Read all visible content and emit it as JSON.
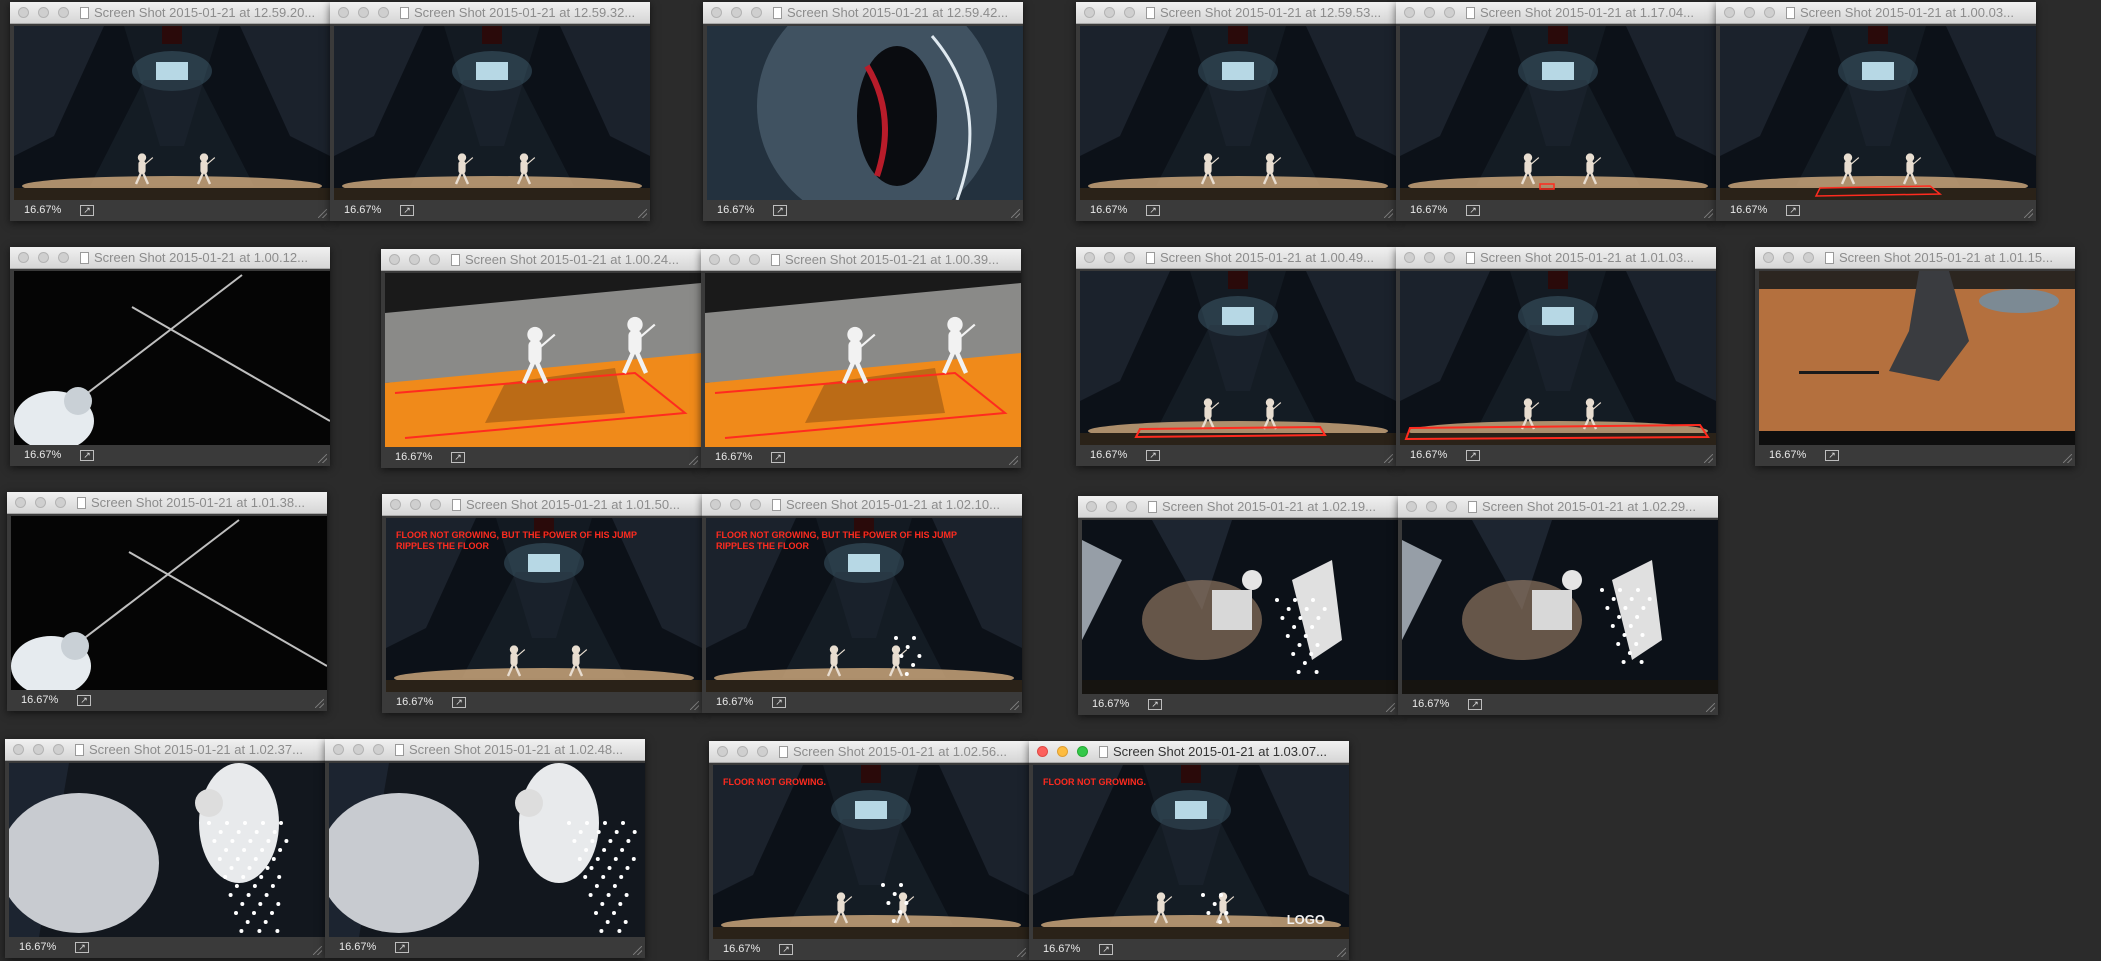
{
  "zoom_label": "16.67%",
  "share_glyph": "↗",
  "colors": {
    "desktop": "#2b2b2b",
    "overlay_red": "#ff2b1f",
    "floor_orange": "#f08a1a",
    "close_red": "#fc605c",
    "minimize_yellow": "#fdbc40",
    "zoom_green": "#34c84a"
  },
  "windows": [
    {
      "title": "Screen Shot 2015-01-21 at 12.59.20...",
      "scene": "arena"
    },
    {
      "title": "Screen Shot 2015-01-21 at 12.59.32...",
      "scene": "arena"
    },
    {
      "title": "Screen Shot 2015-01-21 at 12.59.42...",
      "scene": "mask"
    },
    {
      "title": "Screen Shot 2015-01-21 at 12.59.53...",
      "scene": "arena"
    },
    {
      "title": "Screen Shot 2015-01-21 at 1.17.04...",
      "scene": "arena"
    },
    {
      "title": "Screen Shot 2015-01-21 at 1.00.03...",
      "scene": "arena"
    },
    {
      "title": "Screen Shot 2015-01-21 at 1.00.12...",
      "scene": "blades"
    },
    {
      "title": "Screen Shot 2015-01-21 at 1.00.24...",
      "scene": "orange-floor"
    },
    {
      "title": "Screen Shot 2015-01-21 at 1.00.39...",
      "scene": "orange-floor"
    },
    {
      "title": "Screen Shot 2015-01-21 at 1.00.49...",
      "scene": "arena"
    },
    {
      "title": "Screen Shot 2015-01-21 at 1.01.03...",
      "scene": "arena"
    },
    {
      "title": "Screen Shot 2015-01-21 at 1.01.15...",
      "scene": "shoe"
    },
    {
      "title": "Screen Shot 2015-01-21 at 1.01.38...",
      "scene": "blades"
    },
    {
      "title": "Screen Shot 2015-01-21 at 1.01.50...",
      "scene": "arena",
      "overlay": "FLOOR NOT GROWING, BUT THE POWER OF HIS JUMP RIPPLES THE FLOOR"
    },
    {
      "title": "Screen Shot 2015-01-21 at 1.02.10...",
      "scene": "arena",
      "overlay": "FLOOR NOT GROWING, BUT THE POWER OF HIS JUMP RIPPLES THE FLOOR"
    },
    {
      "title": "Screen Shot 2015-01-21 at 1.02.19...",
      "scene": "lunge"
    },
    {
      "title": "Screen Shot 2015-01-21 at 1.02.29...",
      "scene": "lunge"
    },
    {
      "title": "Screen Shot 2015-01-21 at 1.02.37...",
      "scene": "jump-close"
    },
    {
      "title": "Screen Shot 2015-01-21 at 1.02.48...",
      "scene": "jump-close"
    },
    {
      "title": "Screen Shot 2015-01-21 at 1.02.56...",
      "scene": "arena",
      "overlay": "FLOOR NOT GROWING."
    },
    {
      "title": "Screen Shot 2015-01-21 at 1.03.07...",
      "scene": "arena",
      "overlay": "FLOOR NOT GROWING.",
      "logo": "LOGO",
      "active": true
    }
  ]
}
